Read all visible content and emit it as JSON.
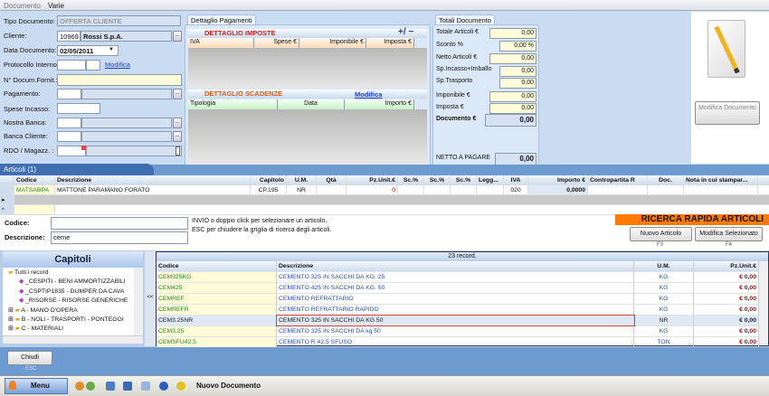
{
  "menu": [
    "Documento",
    "Varie"
  ],
  "form": {
    "tipo_label": "Tipo Documento:",
    "tipo_value": "OFFERTA CLIENTE",
    "cliente_label": "Cliente:",
    "cliente_code": "10969",
    "cliente_name": "Rossi S.p.A.",
    "data_label": "Data Documento:",
    "data_value": "02/05/2011",
    "protocollo_label": "Protocollo Interno:",
    "modifica_link": "Modifica",
    "ndoc_label": "N° Docum.Fornit.:",
    "pagamento_label": "Pagamento:",
    "spese_label": "Spese Incasso:",
    "nostra_banca_label": "Nostra Banca:",
    "banca_cliente_label": "Banca Cliente:",
    "rdo_label": "RDO / Magazz. :",
    "dots": "..."
  },
  "pagamenti": {
    "tab": "Dettaglio Pagamenti",
    "imposte_title": "DETTAGLIO IMPOSTE",
    "plus_minus": "+/ −",
    "imposte_cols": [
      "IVA",
      "Spese €",
      "Imponibile €",
      "Imposta €"
    ],
    "scadenze_title": "DETTAGLIO SCADENZE",
    "scadenze_link": "Modifica",
    "scadenze_cols": [
      "Tipologia",
      "Data",
      "Importo €"
    ]
  },
  "totali": {
    "tab": "Totali Documento",
    "rows": [
      {
        "label": "Totale Articoli €",
        "value": "0,00"
      },
      {
        "label": "Sconto %",
        "value": "0,00 %"
      },
      {
        "label": "Netto Articoli €",
        "value": "0,00"
      },
      {
        "label": "Sp.Incasso+Imballo",
        "value": "0,00"
      },
      {
        "label": "Sp.Trasporto",
        "value": "0,00"
      },
      {
        "label": "Imponibile €",
        "value": "0,00"
      },
      {
        "label": "Imposta €",
        "value": "0,00"
      }
    ],
    "documento_label": "Documento €",
    "documento_value": "0,00",
    "netto_label": "NETTO A PAGARE",
    "netto_value": "0,00"
  },
  "modifica_documento": "Modifica Documento",
  "articoli": {
    "tab": "Articoli (1)",
    "cols": [
      "Codice",
      "Descrizione",
      "Capitolo",
      "U.M.",
      "Qtà",
      "Pz.Unit.€",
      "Sc.%",
      "Sc.%",
      "Sc.%",
      "Legg...",
      "IVA",
      "Importo €",
      "Contropartita R",
      "Doc.",
      "Nota in cui stampar..."
    ],
    "row": {
      "codice": "MATSABPA",
      "descrizione": "MATTONE PARAMANO FORATO",
      "capitolo": "CP.195",
      "um": "NR",
      "pz": "0",
      "iva": "020",
      "importo": "0,0000"
    }
  },
  "ricerca": {
    "codice_label": "Codice:",
    "codice_value": "",
    "descrizione_label": "Descrizione:",
    "descrizione_value": "ceme",
    "help1": "INVIO o doppio click per selezionare un articolo.",
    "help2": "ESC per chiudere la griglia di ricerca degli articoli.",
    "title": "RICERCA RAPIDA ARTICOLI",
    "nuovo": "Nuovo Articolo",
    "nuovo_key": "F3",
    "modifica": "Modifica Selezionato",
    "modifica_key": "F4"
  },
  "capitoli": {
    "title": "Capitoli",
    "items": [
      "Tutti i record",
      "_CESPITI - BENI AMMORTIZZABILI",
      "_CSPTIP1835 - DUMPER DA CAVA",
      "_RISORSE - RISORSE GENERICHE",
      "A - MANO D'OPERA",
      "B - NOLI - TRASPORTI - PONTEGGI",
      "C - MATERIALI"
    ],
    "collapse": "<<"
  },
  "results": {
    "count": "23 record.",
    "cols": [
      "Codice",
      "Descrizione",
      "U.M.",
      "Pz.Unit.€"
    ],
    "rows": [
      {
        "codice": "CEM325KG",
        "descrizione": "CEMENTO 325 IN SACCHI DA KG. 25",
        "um": "KG",
        "prezzo": "€ 0,00"
      },
      {
        "codice": "CEM425",
        "descrizione": "CEMENTO 425 IN SACCHI DA KG. 50",
        "um": "KG",
        "prezzo": "€ 0,00"
      },
      {
        "codice": "CEMREF",
        "descrizione": "CEMENTO REFRATTARIO",
        "um": "KG",
        "prezzo": "€ 0,00"
      },
      {
        "codice": "CEMREFR",
        "descrizione": "CEMENTO REFRATTARIO RAPIDO",
        "um": "KG",
        "prezzo": "€ 0,00"
      },
      {
        "codice": "CEM3.25NR",
        "descrizione": "CEMENTO 325 IN SACCHI DA KG 50",
        "um": "NR",
        "prezzo": "€ 0,00"
      },
      {
        "codice": "CEM3.25",
        "descrizione": "CEMENTO 325 IN SACCHI DA kg 50",
        "um": "KG",
        "prezzo": "€ 0,00"
      },
      {
        "codice": "CEMSFU42.5",
        "descrizione": "CEMENTO R 42,5 SFUSO",
        "um": "TON",
        "prezzo": "€ 0,00"
      }
    ]
  },
  "chiudi": "Chiudi",
  "chiudi_key": "ESC",
  "taskbar": {
    "menu": "Menu",
    "status": "Nuovo Documento"
  }
}
